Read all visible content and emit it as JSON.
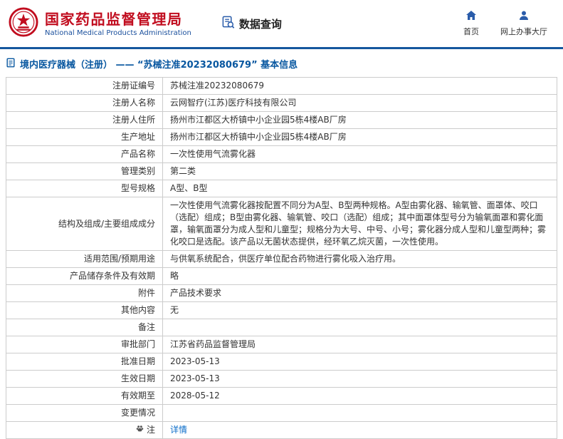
{
  "header": {
    "org_name_cn": "国家药品监督管理局",
    "org_name_en": "National Medical Products Administration",
    "section_title": "数据查询",
    "nav_home": "首页",
    "nav_hall": "网上办事大厅"
  },
  "page": {
    "title": "境内医疗器械（注册） —— “苏械注准20232080679” 基本信息"
  },
  "colors": {
    "brand_red": "#c10d1f",
    "brand_blue": "#1a4f9c",
    "accent_blue": "#15579e",
    "icon_blue": "#2a5caa",
    "link_blue": "#0a6cc9"
  },
  "table": {
    "rows": [
      {
        "label": "注册证编号",
        "value": "苏械注准20232080679"
      },
      {
        "label": "注册人名称",
        "value": "云网智疗(江苏)医疗科技有限公司"
      },
      {
        "label": "注册人住所",
        "value": "扬州市江都区大桥镇中小企业园5栋4楼AB厂房"
      },
      {
        "label": "生产地址",
        "value": "扬州市江都区大桥镇中小企业园5栋4楼AB厂房"
      },
      {
        "label": "产品名称",
        "value": "一次性使用气流雾化器"
      },
      {
        "label": "管理类别",
        "value": "第二类"
      },
      {
        "label": "型号规格",
        "value": "A型、B型"
      },
      {
        "label": "结构及组成/主要组成成分",
        "value": "一次性使用气流雾化器按配置不同分为A型、B型两种规格。A型由雾化器、输氧管、面罩体、咬口（选配）组成；B型由雾化器、输氧管、咬口（选配）组成；其中面罩体型号分为输氧面罩和雾化面罩，输氧面罩分为成人型和儿童型；规格分为大号、中号、小号；雾化器分成人型和儿童型两种；雾化咬口是选配。该产品以无菌状态提供，经环氧乙烷灭菌，一次性使用。"
      },
      {
        "label": "适用范围/预期用途",
        "value": "与供氧系统配合，供医疗单位配合药物进行雾化吸入治疗用。"
      },
      {
        "label": "产品储存条件及有效期",
        "value": "略"
      },
      {
        "label": "附件",
        "value": "产品技术要求"
      },
      {
        "label": "其他内容",
        "value": "无"
      },
      {
        "label": "备注",
        "value": ""
      },
      {
        "label": "审批部门",
        "value": "江苏省药品监督管理局"
      },
      {
        "label": "批准日期",
        "value": "2023-05-13"
      },
      {
        "label": "生效日期",
        "value": "2023-05-13"
      },
      {
        "label": "有效期至",
        "value": "2028-05-12"
      },
      {
        "label": "变更情况",
        "value": ""
      },
      {
        "label": "注",
        "value": "详情",
        "link": true,
        "has_icon": true
      }
    ]
  }
}
